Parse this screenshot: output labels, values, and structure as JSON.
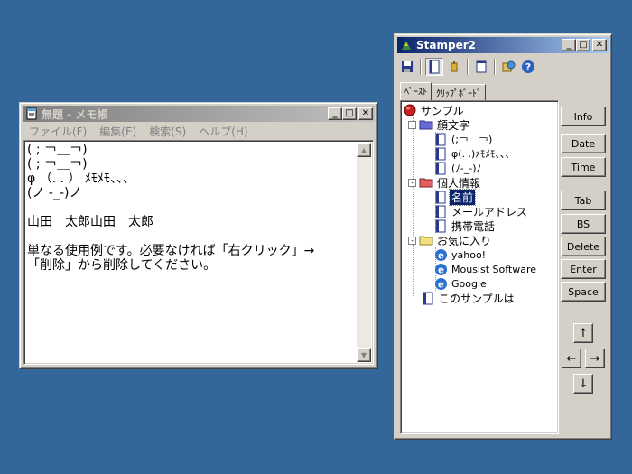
{
  "notepad": {
    "title": "無題 - メモ帳",
    "menu": [
      "ファイル(F)",
      "編集(E)",
      "検索(S)",
      "ヘルプ(H)"
    ],
    "lines": [
      "( ; ￢＿￢)",
      "( ; ￢＿￢)",
      "φ （. . ） ﾒﾓﾒﾓ、、、",
      "(ノ -_-)ノ",
      "",
      "山田　太郎山田　太郎",
      "",
      "単なる使用例です。必要なければ「右クリック」→",
      "「削除」から削除してください。"
    ]
  },
  "stamper": {
    "title": "Stamper2",
    "tabs": [
      "ﾍﾟｰｽﾄ",
      "ｸﾘｯﾌﾟﾎﾞｰﾄﾞ"
    ],
    "tree": {
      "root": "サンプル",
      "kaomoji_folder": "顔文字",
      "kaomoji": [
        "(;￢＿￢)",
        "φ(. .)ﾒﾓﾒﾓ、、、",
        "(ﾉ-_-)ﾉ"
      ],
      "personal_folder": "個人情報",
      "personal": [
        "名前",
        "メールアドレス",
        "携帯電話"
      ],
      "favorites_folder": "お気に入り",
      "favorites": [
        "yahoo!",
        "Mousist Software",
        "Google"
      ],
      "about": "このサンプルは"
    },
    "buttons": {
      "info": "Info",
      "date": "Date",
      "time": "Time",
      "tab": "Tab",
      "bs": "BS",
      "delete": "Delete",
      "enter": "Enter",
      "space": "Space"
    },
    "arrows": {
      "up": "↑",
      "left": "←",
      "right": "→",
      "down": "↓"
    }
  }
}
